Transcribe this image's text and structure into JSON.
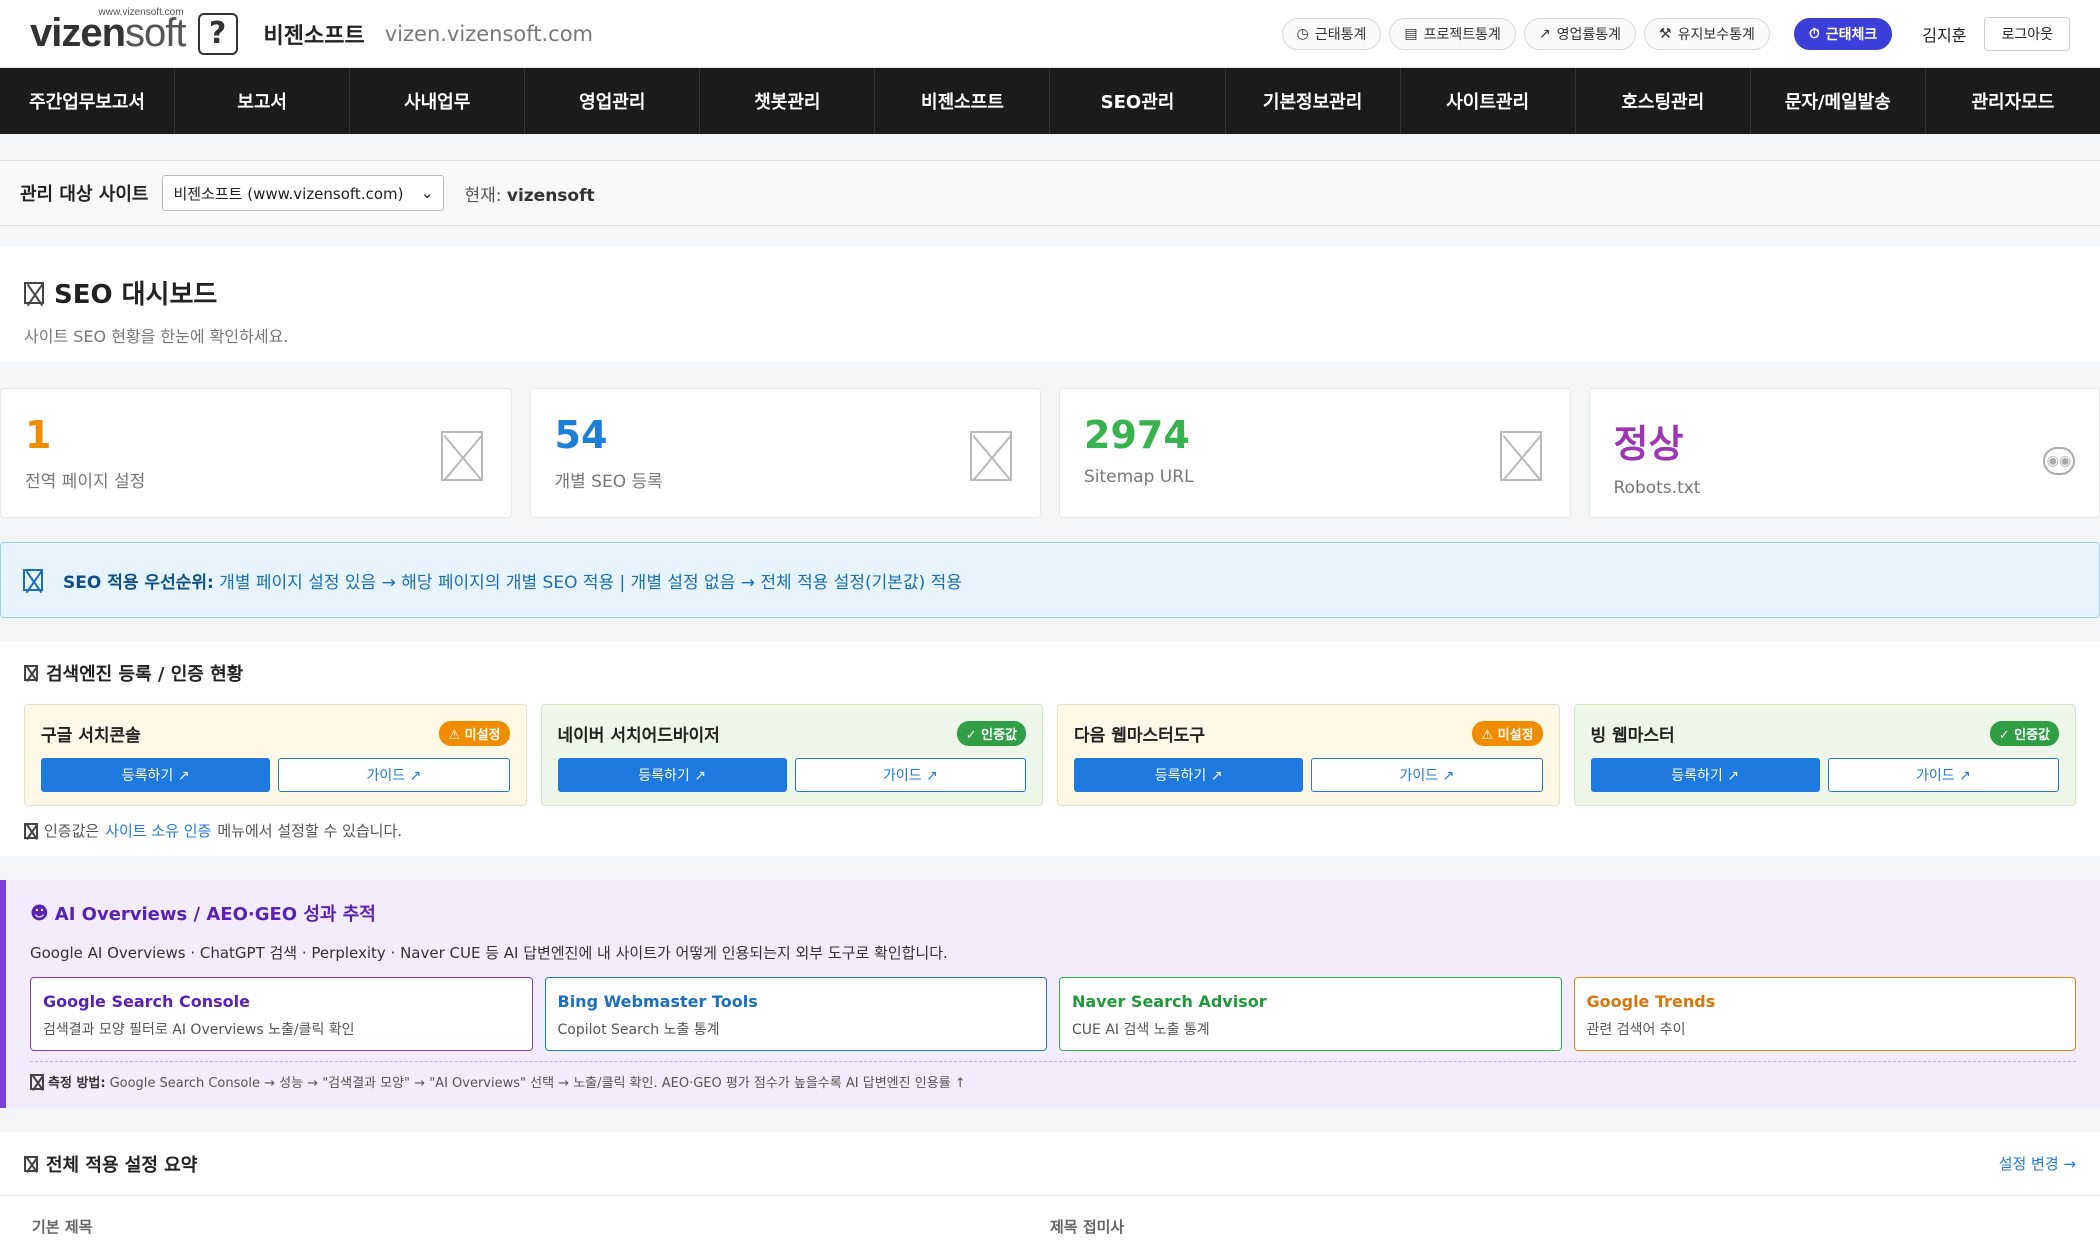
{
  "header": {
    "logo_small": "www.vizensoft.com",
    "logo_main": "vizen",
    "logo_soft": "soft",
    "logo_q": "?",
    "brand_name": "비젠소프트",
    "brand_url": "vizen.vizensoft.com",
    "pills": [
      {
        "label": "근태통계",
        "icon": "clock-icon",
        "glyph": "◷"
      },
      {
        "label": "프로젝트통계",
        "icon": "clipboard-icon",
        "glyph": "▤"
      },
      {
        "label": "영업률통계",
        "icon": "trend-up-icon",
        "glyph": "↗"
      },
      {
        "label": "유지보수통계",
        "icon": "wrench-icon",
        "glyph": "⚒"
      }
    ],
    "checkin_label": "근태체크",
    "checkin_glyph": "⏱",
    "user_name": "김지훈",
    "logout_label": "로그아웃"
  },
  "nav": [
    "주간업무보고서",
    "보고서",
    "사내업무",
    "영업관리",
    "챗봇관리",
    "비젠소프트",
    "SEO관리",
    "기본정보관리",
    "사이트관리",
    "호스팅관리",
    "문자/메일발송",
    "관리자모드"
  ],
  "site_bar": {
    "label": "관리 대상 사이트",
    "selected": "비젠소프트 (www.vizensoft.com)",
    "current_prefix": "현재:",
    "current_value": "vizensoft"
  },
  "dashboard": {
    "title": "SEO 대시보드",
    "subtitle": "사이트 SEO 현황을 한눈에 확인하세요."
  },
  "stats": [
    {
      "value": "1",
      "label": "전역 페이지 설정",
      "color": "#f08c00"
    },
    {
      "value": "54",
      "label": "개별 SEO 등록",
      "color": "#1c7ed6"
    },
    {
      "value": "2974",
      "label": "Sitemap URL",
      "color": "#37b24d"
    },
    {
      "value": "정상",
      "label": "Robots.txt",
      "color": "#9c36b5"
    }
  ],
  "priority": {
    "bold": "SEO 적용 우선순위:",
    "text": " 개별 페이지 설정 있음 → 해당 페이지의 개별 SEO 적용 | 개별 설정 없음 → 전체 적용 설정(기본값) 적용"
  },
  "engines": {
    "title": "검색엔진 등록 / 인증 현황",
    "items": [
      {
        "name": "구글 서치콘솔",
        "badge": "⚠ 미설정",
        "status": "warn",
        "register": "등록하기 ↗",
        "guide": "가이드 ↗"
      },
      {
        "name": "네이버 서치어드바이저",
        "badge": "✓ 인증값",
        "status": "ok",
        "register": "등록하기 ↗",
        "guide": "가이드 ↗"
      },
      {
        "name": "다음 웹마스터도구",
        "badge": "⚠ 미설정",
        "status": "warn",
        "register": "등록하기 ↗",
        "guide": "가이드 ↗"
      },
      {
        "name": "빙 웹마스터",
        "badge": "✓ 인증값",
        "status": "ok",
        "register": "등록하기 ↗",
        "guide": "가이드 ↗"
      }
    ],
    "note_before": "인증값은",
    "note_link": "사이트 소유 인증",
    "note_after": "메뉴에서 설정할 수 있습니다."
  },
  "ai": {
    "title": "AI Overviews / AEO·GEO 성과 추적",
    "title_glyph": "☻",
    "desc": "Google AI Overviews · ChatGPT 검색 · Perplexity · Naver CUE 등 AI 답변엔진에 내 사이트가 어떻게 인용되는지 외부 도구로 확인합니다.",
    "tools": [
      {
        "name": "Google Search Console",
        "desc": "검색결과 모양 필터로 AI Overviews 노출/클릭 확인",
        "color": "#7b3fd8"
      },
      {
        "name": "Bing Webmaster Tools",
        "desc": "Copilot Search 노출 통계",
        "color": "#1c7ed6"
      },
      {
        "name": "Naver Search Advisor",
        "desc": "CUE AI 검색 노출 통계",
        "color": "#2fb344"
      },
      {
        "name": "Google Trends",
        "desc": "관련 검색어 추이",
        "color": "#e8830c"
      }
    ],
    "note_bold": "측정 방법:",
    "note_text": " Google Search Console → 성능 → \"검색결과 모양\" → \"AI Overviews\" 선택 → 노출/클릭 확인. AEO·GEO 평가 점수가 높을수록 AI 답변엔진 인용률 ↑"
  },
  "summary": {
    "title": "전체 적용 설정 요약",
    "link": "설정 변경 →",
    "col1": "기본 제목",
    "col2": "제목 접미사"
  }
}
